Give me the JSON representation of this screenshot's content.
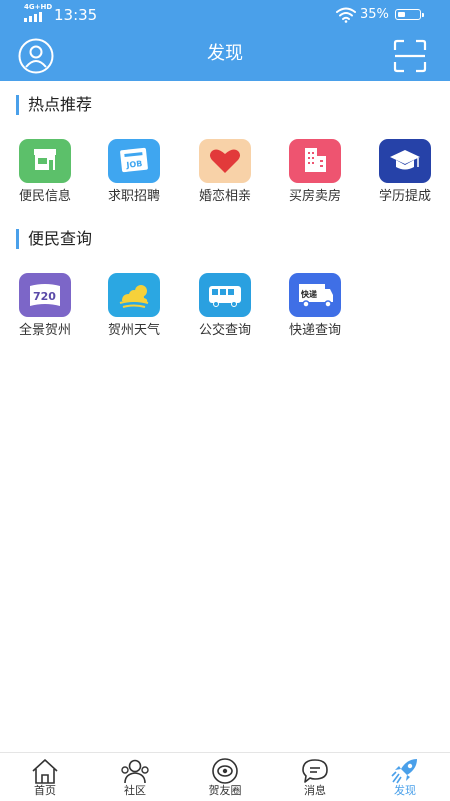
{
  "status_bar": {
    "network": "4G+HD",
    "time": "13:35",
    "battery_percent": "35%",
    "battery_level": 0.35
  },
  "app_bar": {
    "title": "发现",
    "left_icon": "user-avatar-icon",
    "right_icon": "scan-icon"
  },
  "hot_section": {
    "title": "热点推荐",
    "items": [
      {
        "label": "便民信息",
        "icon": "shop-icon",
        "color": "#5CC06A"
      },
      {
        "label": "求职招聘",
        "icon": "job-card-icon",
        "color": "#3FA6F0"
      },
      {
        "label": "婚恋相亲",
        "icon": "heart-icon",
        "color": "#F8D2A8"
      },
      {
        "label": "买房卖房",
        "icon": "building-icon",
        "color": "#EE5470"
      },
      {
        "label": "学历提成",
        "icon": "graduation-cap-icon",
        "color": "#2642A8"
      }
    ]
  },
  "convenience_section": {
    "title": "便民查询",
    "items": [
      {
        "label": "全景贺州",
        "icon": "panorama-720-icon",
        "color": "#7C66C8",
        "badge": "720"
      },
      {
        "label": "贺州天气",
        "icon": "weather-icon",
        "color": "#2BA7E2"
      },
      {
        "label": "公交查询",
        "icon": "bus-icon",
        "color": "#2AA0E0"
      },
      {
        "label": "快递查询",
        "icon": "delivery-truck-icon",
        "color": "#3F6FE6",
        "badge": "快递"
      }
    ]
  },
  "bottom_nav": {
    "active_color": "#4AA0EA",
    "items": [
      {
        "label": "首页",
        "icon": "home-icon"
      },
      {
        "label": "社区",
        "icon": "community-icon"
      },
      {
        "label": "贺友圈",
        "icon": "moments-icon"
      },
      {
        "label": "消息",
        "icon": "message-icon"
      },
      {
        "label": "发现",
        "icon": "discover-rocket-icon",
        "active": true
      }
    ]
  }
}
